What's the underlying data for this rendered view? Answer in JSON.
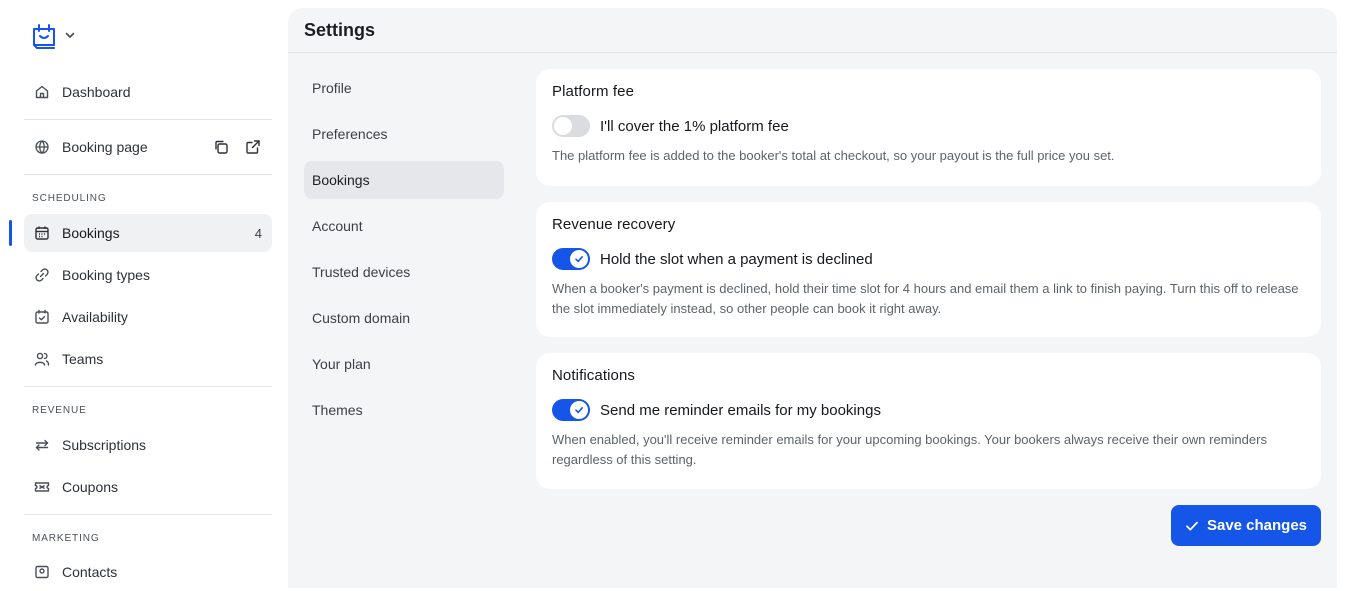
{
  "sidebar": {
    "top_items": [
      {
        "label": "Dashboard",
        "icon": "home-icon"
      },
      {
        "label": "Booking page",
        "icon": "globe-icon"
      }
    ],
    "sections": [
      {
        "title": "SCHEDULING",
        "items": [
          {
            "label": "Bookings",
            "icon": "calendar-icon",
            "badge": "4",
            "active": true
          },
          {
            "label": "Booking types",
            "icon": "link-icon"
          },
          {
            "label": "Availability",
            "icon": "calendar-check-icon"
          },
          {
            "label": "Teams",
            "icon": "users-icon"
          }
        ]
      },
      {
        "title": "REVENUE",
        "items": [
          {
            "label": "Subscriptions",
            "icon": "repeat-icon"
          },
          {
            "label": "Coupons",
            "icon": "ticket-icon"
          }
        ]
      },
      {
        "title": "MARKETING",
        "items": [
          {
            "label": "Contacts",
            "icon": "contacts-icon"
          }
        ]
      }
    ]
  },
  "settings": {
    "title": "Settings",
    "nav": [
      "Profile",
      "Preferences",
      "Bookings",
      "Account",
      "Trusted devices",
      "Custom domain",
      "Your plan",
      "Themes"
    ],
    "active_nav": "Bookings",
    "cards": [
      {
        "title": "Platform fee",
        "toggle_label": "I'll cover the 1% platform fee",
        "enabled": false,
        "description": "The platform fee is added to the booker's total at checkout, so your payout is the full price you set."
      },
      {
        "title": "Revenue recovery",
        "toggle_label": "Hold the slot when a payment is declined",
        "enabled": true,
        "description": "When a booker's payment is declined, hold their time slot for 4 hours and email them a link to finish paying. Turn this off to release the slot immediately instead, so other people can book it right away."
      },
      {
        "title": "Notifications",
        "toggle_label": "Send me reminder emails for my bookings",
        "enabled": true,
        "description": "When enabled, you'll receive reminder emails for your upcoming bookings. Your bookers always receive their own reminders regardless of this setting."
      }
    ],
    "save_label": "Save changes"
  },
  "colors": {
    "accent": "#1556e8",
    "active_bg": "#f0f1f3",
    "panel_bg": "#f4f5f6"
  }
}
